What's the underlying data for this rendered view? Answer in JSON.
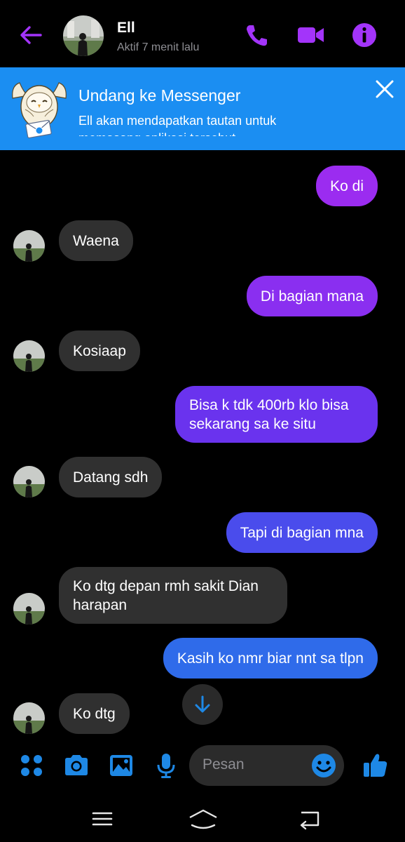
{
  "header": {
    "contact_name": "Ell",
    "status": "Aktif 7 menit lalu",
    "accent_color": "#a334fa",
    "icons": [
      "back-arrow-icon",
      "phone-icon",
      "video-camera-icon",
      "info-icon"
    ]
  },
  "banner": {
    "title": "Undang ke Messenger",
    "subtitle": "Ell akan mendapatkan tautan untuk memasang aplikasi tersebut",
    "background": "#1b8ef2"
  },
  "messages": [
    {
      "direction": "out",
      "text": "Ko di"
    },
    {
      "direction": "in",
      "text": "Waena"
    },
    {
      "direction": "out",
      "text": "Di bagian mana"
    },
    {
      "direction": "in",
      "text": "Kosiaap"
    },
    {
      "direction": "out",
      "text": "Bisa k tdk 400rb klo bisa sekarang sa ke situ"
    },
    {
      "direction": "in",
      "text": "Datang sdh"
    },
    {
      "direction": "out",
      "text": "Tapi di bagian mna"
    },
    {
      "direction": "in",
      "text": "Ko dtg depan rmh sakit Dian harapan"
    },
    {
      "direction": "out",
      "text": "Kasih ko nmr biar nnt sa tlpn"
    },
    {
      "direction": "in",
      "text": "Ko dtg"
    }
  ],
  "composer": {
    "placeholder": "Pesan",
    "accent_color": "#1e88e5",
    "icons": [
      "apps-grid-icon",
      "camera-icon",
      "image-icon",
      "microphone-icon",
      "emoji-icon",
      "thumbs-up-icon"
    ]
  },
  "colors": {
    "incoming_bubble": "#303030",
    "outgoing_gradient": [
      "#9b2cf0",
      "#2f6bea"
    ]
  }
}
